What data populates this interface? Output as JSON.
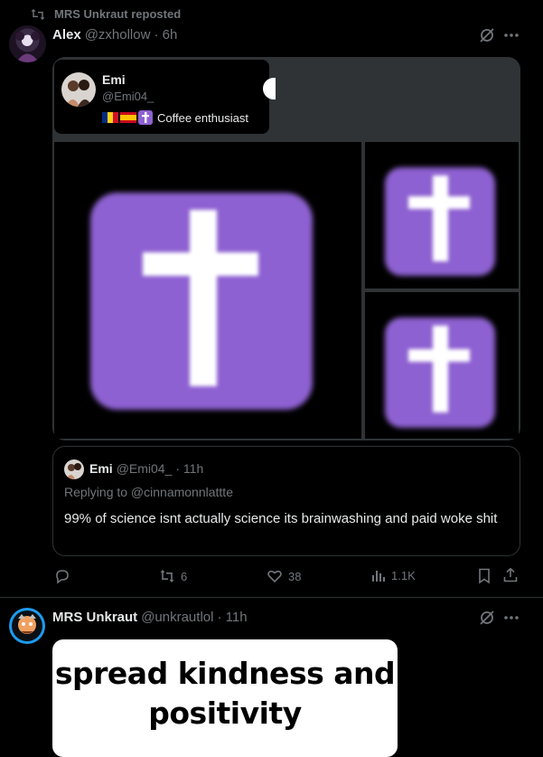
{
  "repost": {
    "icon": "repost-icon",
    "text": "MRS Unkraut reposted"
  },
  "tweet1": {
    "name": "Alex",
    "handle": "@zxhollow",
    "time": "· 6h",
    "grok_icon": "grok-icon",
    "more_icon": "more-icon",
    "profile_popup": {
      "name": "Emi",
      "handle": "@Emi04_",
      "bio": "Coffee enthusiast",
      "flags": [
        "romania-flag",
        "spain-flag",
        "latin-cross-icon"
      ]
    },
    "images": [
      "purple-cross-image",
      "purple-cross-image",
      "purple-cross-image"
    ],
    "quote": {
      "name": "Emi",
      "handle": "@Emi04_",
      "time": "· 11h",
      "replying_to": "Replying to @cinnamonnlattte",
      "text": "99% of science isnt actually science its brainwashing and paid woke shit"
    },
    "actions": {
      "reply_count": "",
      "repost_count": "6",
      "like_count": "38",
      "views_count": "1.1K"
    }
  },
  "tweet2": {
    "name": "MRS Unkraut",
    "handle": "@unkrautlol",
    "time": "· 11h",
    "grok_icon": "grok-icon",
    "more_icon": "more-icon",
    "meme_line1": "spread kindness and",
    "meme_line2": "positivity"
  }
}
